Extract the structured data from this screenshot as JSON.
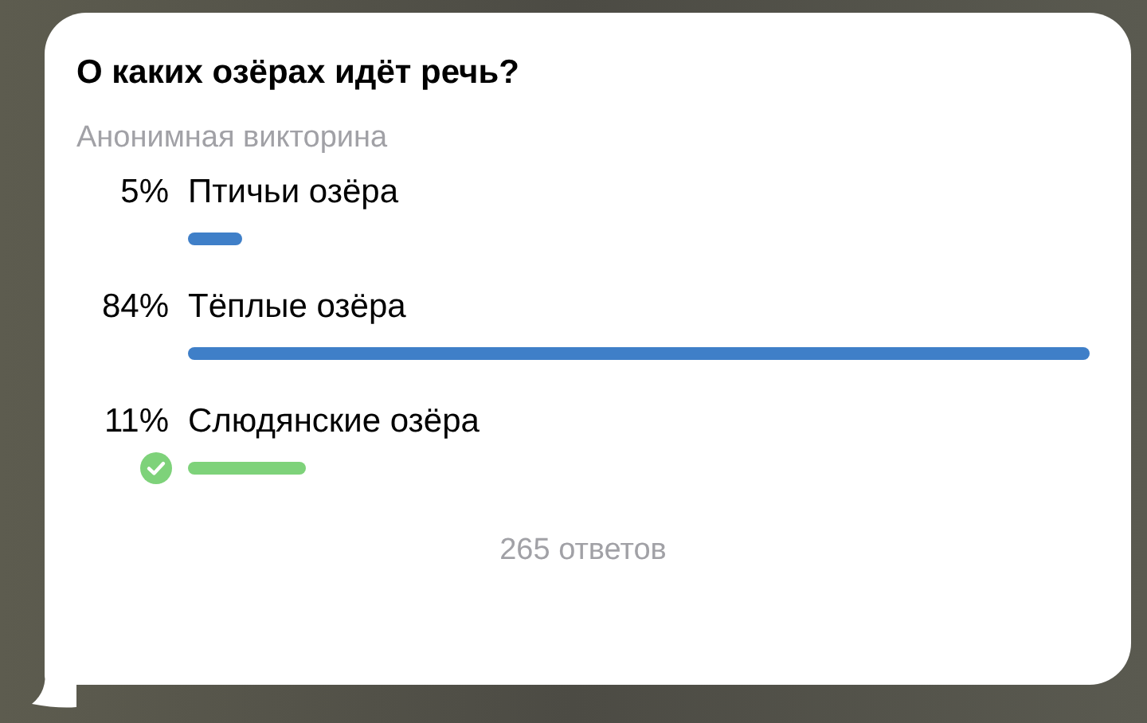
{
  "poll": {
    "question": "О каких озёрах идёт речь?",
    "type_label": "Анонимная викторина",
    "options": [
      {
        "percent": "5%",
        "label": "Птичьи озёра",
        "correct": false
      },
      {
        "percent": "84%",
        "label": "Тёплые озёра",
        "correct": false
      },
      {
        "percent": "11%",
        "label": "Слюдянские озёра",
        "correct": true
      }
    ],
    "total": "265 ответов"
  }
}
